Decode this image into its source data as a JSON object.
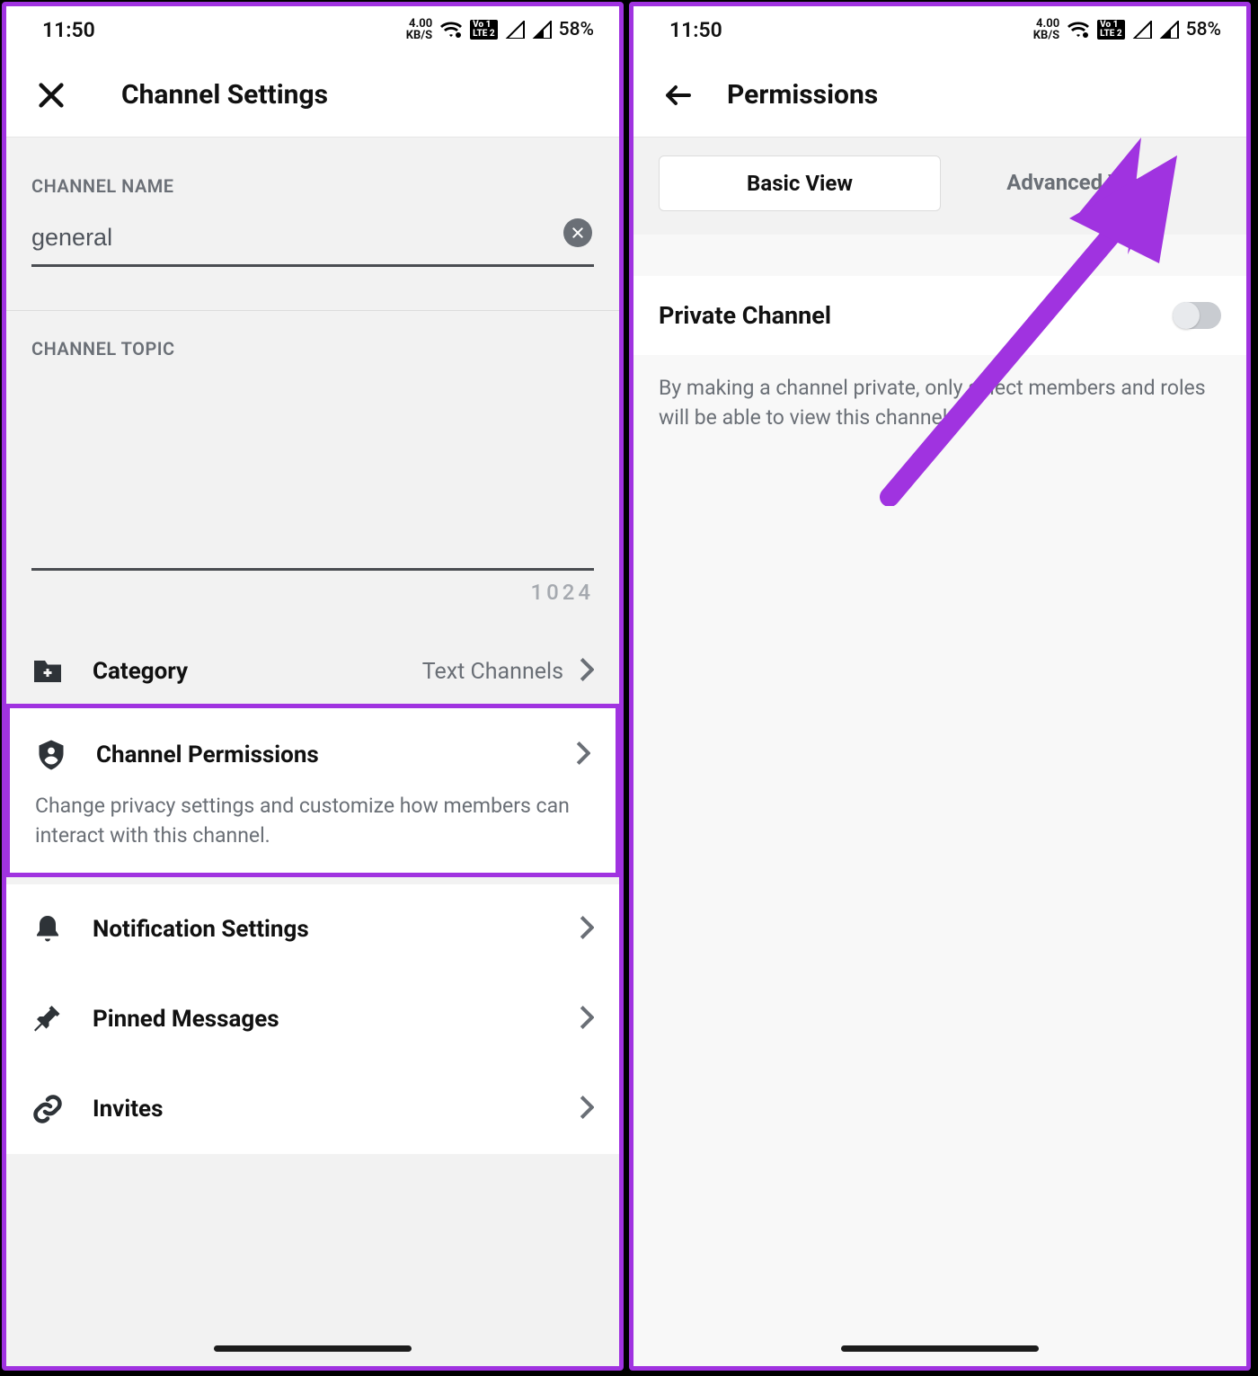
{
  "status": {
    "time": "11:50",
    "net_speed_top": "4.00",
    "net_speed_bot": "KB/S",
    "lte_top": "Vo 1",
    "lte_bot": "LTE 2",
    "battery": "58%"
  },
  "left": {
    "title": "Channel Settings",
    "channel_name_label": "CHANNEL NAME",
    "channel_name_value": "general",
    "channel_topic_label": "CHANNEL TOPIC",
    "topic_counter": "1024",
    "category_label": "Category",
    "category_value": "Text Channels",
    "permissions_label": "Channel Permissions",
    "permissions_desc": "Change privacy settings and customize how members can interact with this channel.",
    "notif_label": "Notification Settings",
    "pinned_label": "Pinned Messages",
    "invites_label": "Invites"
  },
  "right": {
    "title": "Permissions",
    "tab_basic": "Basic View",
    "tab_advanced": "Advanced View",
    "private_title": "Private Channel",
    "private_desc": "By making a channel private, only select members and roles will be able to view this channel."
  }
}
